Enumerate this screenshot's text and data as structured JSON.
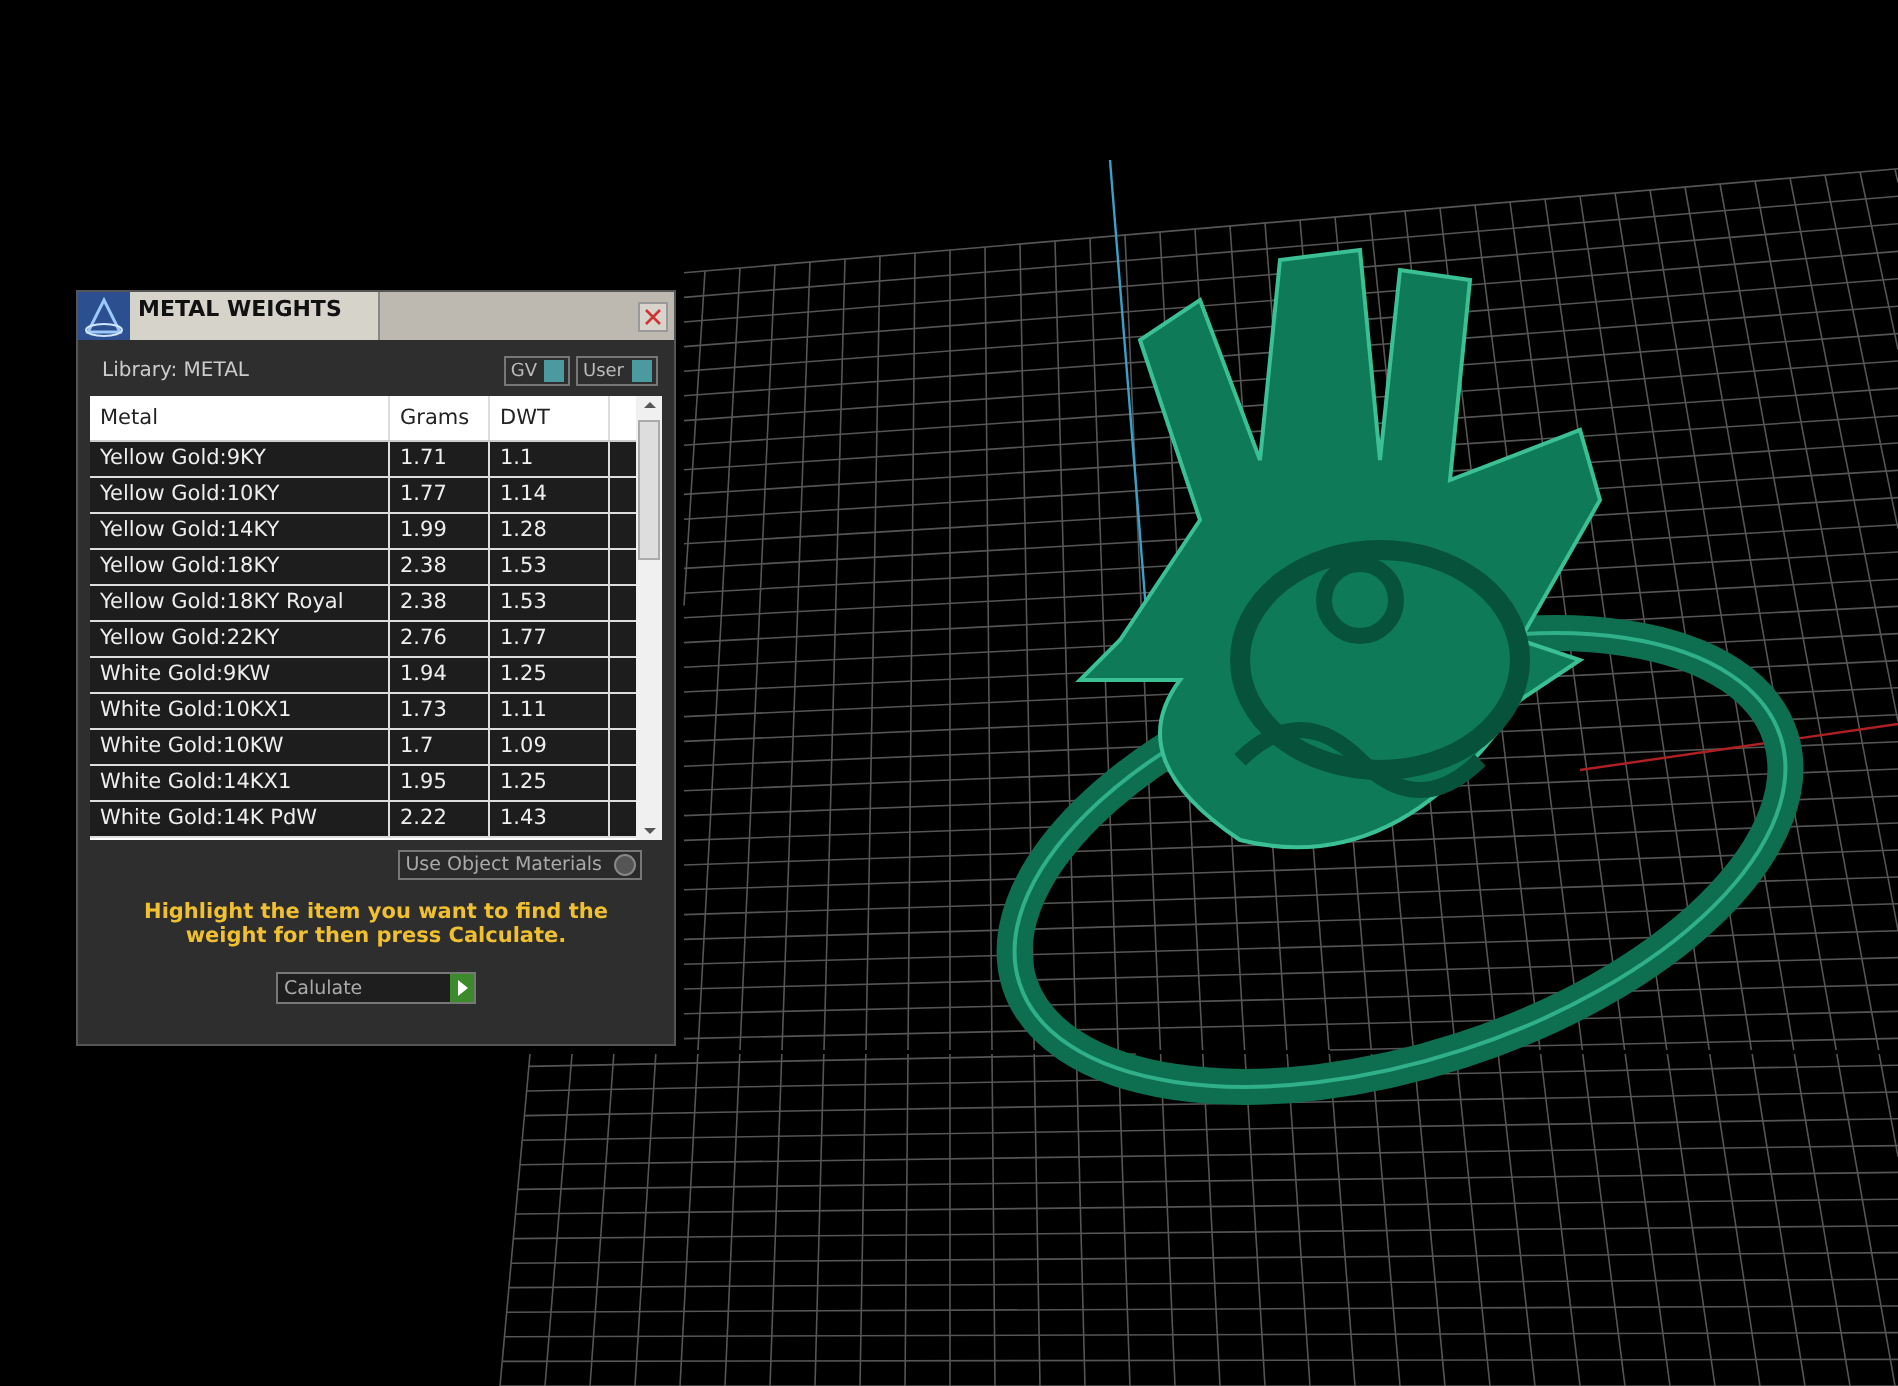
{
  "window": {
    "title": "METAL WEIGHTS"
  },
  "library": {
    "label": "Library: METAL"
  },
  "toggles": [
    {
      "label": "GV",
      "on": true
    },
    {
      "label": "User",
      "on": true
    }
  ],
  "table": {
    "columns": [
      "Metal",
      "Grams",
      "DWT"
    ],
    "rows": [
      [
        "Yellow Gold:9KY",
        "1.71",
        "1.1"
      ],
      [
        "Yellow Gold:10KY",
        "1.77",
        "1.14"
      ],
      [
        "Yellow Gold:14KY",
        "1.99",
        "1.28"
      ],
      [
        "Yellow Gold:18KY",
        "2.38",
        "1.53"
      ],
      [
        "Yellow Gold:18KY Royal",
        "2.38",
        "1.53"
      ],
      [
        "Yellow Gold:22KY",
        "2.76",
        "1.77"
      ],
      [
        "White Gold:9KW",
        "1.94",
        "1.25"
      ],
      [
        "White Gold:10KX1",
        "1.73",
        "1.11"
      ],
      [
        "White Gold:10KW",
        "1.7",
        "1.09"
      ],
      [
        "White Gold:14KX1",
        "1.95",
        "1.25"
      ],
      [
        "White Gold:14K PdW",
        "2.22",
        "1.43"
      ]
    ]
  },
  "object_materials": {
    "label": "Use Object Materials",
    "on": false
  },
  "hint": "Highlight the item you want to find the weight for then press Calculate.",
  "calculate_button": "Calulate"
}
